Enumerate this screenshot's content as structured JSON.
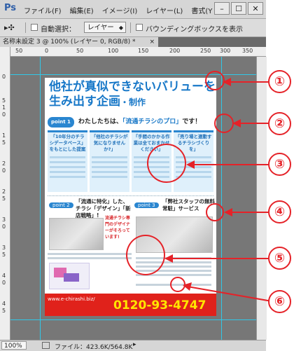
{
  "app": {
    "logo": "Ps",
    "menu": [
      "ファイル(F)",
      "編集(E)",
      "イメージ(I)",
      "レイヤー(L)",
      "書式(Y"
    ],
    "window_controls": [
      "–",
      "☐",
      "✕"
    ]
  },
  "options": {
    "move_glyph": "▸✣",
    "auto_select_label": "自動選択：",
    "layer_select": "レイヤー",
    "bbox_label": "バウンディングボックスを表示"
  },
  "document": {
    "tab_title": "名称未設定 3 @ 100% (レイヤー 0, RGB/8) *",
    "close_glyph": "×"
  },
  "ruler": {
    "h_ticks": [
      "50",
      "0",
      "50",
      "100",
      "150",
      "200",
      "250",
      "300",
      "350"
    ],
    "v_ticks": [
      "0",
      "5",
      "1",
      "0",
      "1",
      "5",
      "2",
      "0",
      "2",
      "5",
      "3",
      "0",
      "3",
      "5",
      "4",
      "0",
      "4",
      "5"
    ]
  },
  "status": {
    "zoom": "100%",
    "file_info": "ファイル：423.6K/564.8K",
    "arrow": "▸"
  },
  "flyer": {
    "title_line1_a": "他社が",
    "title_line1_b": "真似できないバリューを",
    "title_line2_a": "生み出す",
    "title_line2_b": "企画",
    "title_line2_c": "・制作",
    "section1_badge": "point 1",
    "section1_text_a": "わたしたちは、",
    "section1_text_b": "「流通チラシのプロ」",
    "section1_text_c": "です！",
    "box1": "「10年分のチラシデータベース」をもとにした提案",
    "box2": "「他社のチラシが気になりませんか?」",
    "box3": "「手間のかかる作業は全ておまかせください」",
    "box4": "「売り場と連動するチラシづくりを」",
    "section2_badge": "point 2",
    "section2_text": "「流通に特化」した、チラシ「デザイン」「新店戦略」!",
    "section2_note": "流通チラシ専門のデザイナーがそろっています!",
    "section3_badge": "point 3",
    "section3_text": "「弊社スタッフの無料常駐」サービス",
    "footer_url": "www.e-chirashi.biz/",
    "footer_phone": "0120-93-4747"
  },
  "callouts": [
    "①",
    "②",
    "③",
    "④",
    "⑤",
    "⑥"
  ],
  "colors": {
    "callout_red": "#e52228",
    "flyer_blue": "#1878c8",
    "guide_cyan": "#30c8e8",
    "footer_red": "#e0221b",
    "phone_yellow": "#ffe600"
  }
}
